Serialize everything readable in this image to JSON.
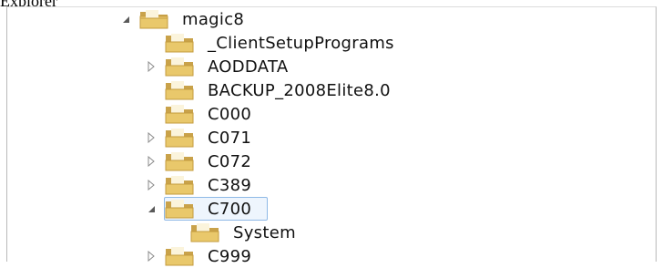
{
  "header_fragment": "Explorer",
  "tree": {
    "items": [
      {
        "label": "magic8",
        "arrow": "expanded"
      },
      {
        "label": "_ClientSetupPrograms",
        "arrow": "none"
      },
      {
        "label": "AODDATA",
        "arrow": "collapsed"
      },
      {
        "label": "BACKUP_2008Elite8.0",
        "arrow": "none"
      },
      {
        "label": "C000",
        "arrow": "none"
      },
      {
        "label": "C071",
        "arrow": "collapsed"
      },
      {
        "label": "C072",
        "arrow": "collapsed"
      },
      {
        "label": "C389",
        "arrow": "collapsed"
      },
      {
        "label": "C700",
        "arrow": "expanded",
        "selected": true
      },
      {
        "label": "System",
        "arrow": "none"
      },
      {
        "label": "C999",
        "arrow": "collapsed"
      }
    ]
  },
  "colors": {
    "selection_border": "#8fb9e6",
    "selection_fill": "#eef5fd",
    "folder": "#e9c86b"
  }
}
